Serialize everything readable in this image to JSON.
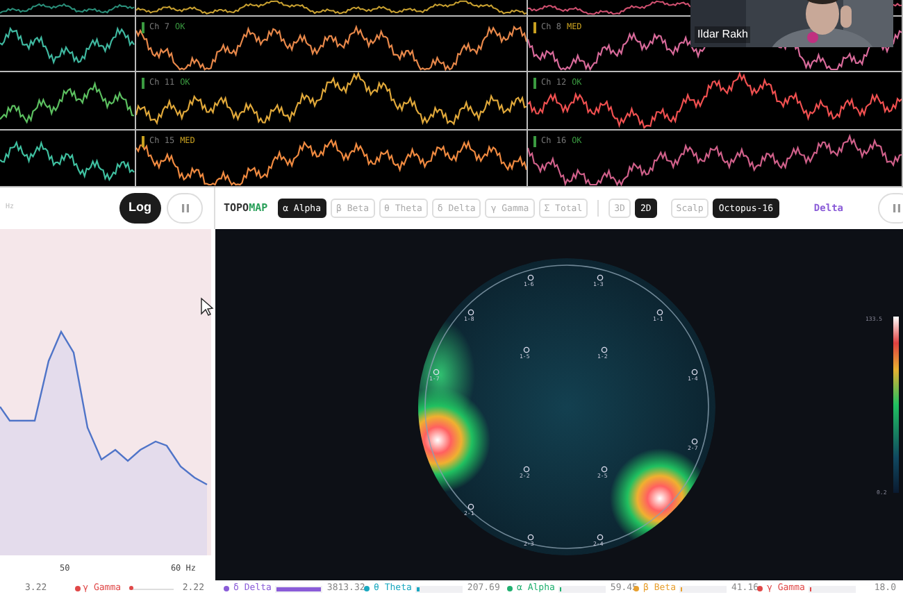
{
  "eeg": {
    "rows": [
      {
        "cells": [
          {
            "color": "#2a8f7a"
          },
          {
            "color": "#c8a030"
          },
          {
            "color": "#d05070"
          }
        ]
      },
      {
        "cells": [
          {
            "color": "#3fb8a0"
          },
          {
            "color": "#e8884a",
            "label": "Ch 7",
            "status": "OK",
            "warn": false
          },
          {
            "color": "#d86a9a",
            "label": "Ch 8",
            "status": "MED",
            "warn": true
          }
        ]
      },
      {
        "cells": [
          {
            "color": "#5cc060"
          },
          {
            "color": "#e0a83a",
            "label": "Ch 11",
            "status": "OK",
            "warn": false
          },
          {
            "color": "#f05050",
            "label": "Ch 12",
            "status": "OK",
            "warn": false
          }
        ]
      },
      {
        "cells": [
          {
            "color": "#3fc0a0"
          },
          {
            "color": "#f08a40",
            "label": "Ch 15",
            "status": "MED",
            "warn": true
          },
          {
            "color": "#d0608a",
            "label": "Ch 16",
            "status": "OK",
            "warn": false
          }
        ]
      }
    ]
  },
  "video": {
    "name": "Ildar Rakh"
  },
  "spectrum": {
    "unit_hint": "Hz",
    "scale_button": "Log",
    "xticks": [
      "50",
      "60 Hz"
    ],
    "legend": {
      "low": "3.22",
      "name": "γ Gamma",
      "color": "#e04848",
      "level": 0,
      "high": "2.22"
    }
  },
  "topomap": {
    "title_lead": "TOPO",
    "title_accent": "MAP",
    "bands": [
      {
        "label": "α Alpha",
        "selected": true
      },
      {
        "label": "β Beta",
        "selected": false
      },
      {
        "label": "θ Theta",
        "selected": false
      },
      {
        "label": "δ Delta",
        "selected": false
      },
      {
        "label": "γ Gamma",
        "selected": false
      },
      {
        "label": "Σ Total",
        "selected": false
      }
    ],
    "views": [
      {
        "label": "3D",
        "selected": false
      },
      {
        "label": "2D",
        "selected": true
      }
    ],
    "montages": [
      {
        "label": "Scalp",
        "selected": false
      },
      {
        "label": "Octopus-16",
        "selected": true
      }
    ],
    "band_readout": "Delta",
    "electrodes": [
      "1-6",
      "1-3",
      "1-8",
      "1-1",
      "1-5",
      "1-2",
      "1-7",
      "1-4",
      "2-7",
      "2-2",
      "2-5",
      "2-1",
      "2-3",
      "2-4"
    ],
    "scale_max": "133.5",
    "scale_min": "0.2"
  },
  "band_powers": [
    {
      "name": "δ Delta",
      "color": "#8a5cd8",
      "level": 1,
      "value": "3813.32"
    },
    {
      "name": "θ Theta",
      "color": "#1aa8c0",
      "level": 0.06,
      "value": "207.69"
    },
    {
      "name": "α Alpha",
      "color": "#20b070",
      "level": 0.03,
      "value": "59.45"
    },
    {
      "name": "β Beta",
      "color": "#e8a030",
      "level": 0.02,
      "value": "41.16"
    },
    {
      "name": "γ Gamma",
      "color": "#e04848",
      "level": 0.01,
      "value": "18.0"
    }
  ]
}
